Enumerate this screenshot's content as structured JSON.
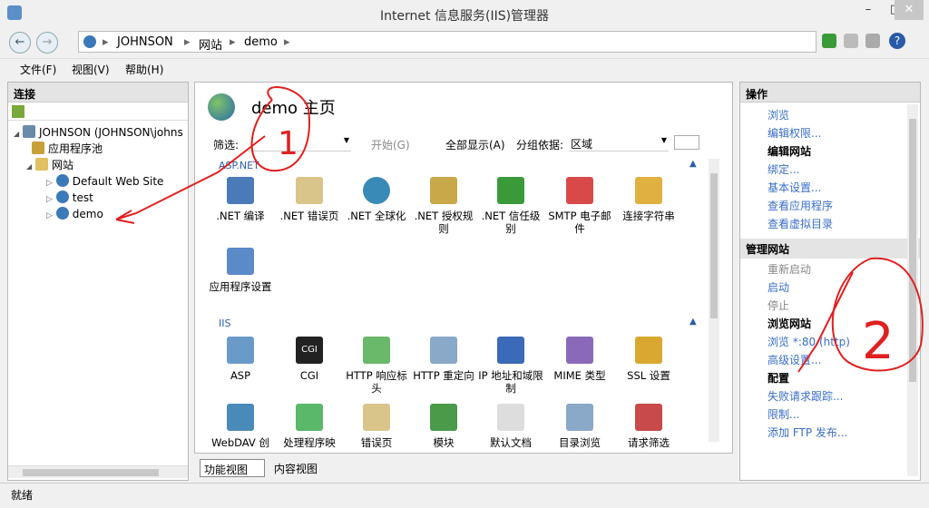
{
  "window": {
    "title": "Internet 信息服务(IIS)管理器",
    "min": "–",
    "max": "□",
    "close": "✕"
  },
  "address": {
    "crumbs": [
      "JOHNSON",
      "网站",
      "demo"
    ],
    "sep": "▸"
  },
  "menu": [
    "文件(F)",
    "视图(V)",
    "帮助(H)"
  ],
  "connections": {
    "title": "连接",
    "tree": [
      {
        "label": "JOHNSON (JOHNSON\\johns",
        "level": 0,
        "toggle": "◢"
      },
      {
        "label": "应用程序池",
        "level": 1,
        "toggle": ""
      },
      {
        "label": "网站",
        "level": 1,
        "toggle": "◢"
      },
      {
        "label": "Default Web Site",
        "level": 2,
        "toggle": "▷"
      },
      {
        "label": "test",
        "level": 2,
        "toggle": "▷"
      },
      {
        "label": "demo",
        "level": 2,
        "toggle": "▷"
      }
    ]
  },
  "main": {
    "title": "demo 主页",
    "filter_label": "筛选:",
    "start_label": "开始(G)",
    "show_all_label": "全部显示(A)",
    "group_label": "分组依据:",
    "group_value": "区域",
    "sections": [
      {
        "name": "ASP.NET",
        "items": [
          ".NET 编译",
          ".NET 错误页",
          ".NET 全球化",
          ".NET 授权规则",
          ".NET 信任级别",
          "SMTP 电子邮件",
          "连接字符串",
          "应用程序设置"
        ]
      },
      {
        "name": "IIS",
        "items": [
          "ASP",
          "CGI",
          "HTTP 响应标头",
          "HTTP 重定向",
          "IP 地址和域限制",
          "MIME 类型",
          "SSL 设置",
          "WebDAV 创",
          "处理程序映",
          "错误页",
          "模块",
          "默认文档",
          "目录浏览",
          "请求筛选"
        ]
      }
    ],
    "bottom_tabs": [
      "功能视图",
      "内容视图"
    ]
  },
  "actions": {
    "title": "操作",
    "items": [
      {
        "text": "浏览",
        "kind": "link"
      },
      {
        "text": "编辑权限...",
        "kind": "link"
      },
      {
        "text": "编辑网站",
        "kind": "head"
      },
      {
        "text": "绑定...",
        "kind": "link"
      },
      {
        "text": "基本设置...",
        "kind": "link"
      },
      {
        "text": "查看应用程序",
        "kind": "link"
      },
      {
        "text": "查看虚拟目录",
        "kind": "link"
      }
    ],
    "manage_title": "管理网站",
    "manage_items": [
      {
        "text": "重新启动",
        "kind": "dis"
      },
      {
        "text": "启动",
        "kind": "link"
      },
      {
        "text": "停止",
        "kind": "dis"
      },
      {
        "text": "浏览网站",
        "kind": "head"
      },
      {
        "text": "浏览 *:80 (http)",
        "kind": "link"
      },
      {
        "text": "高级设置...",
        "kind": "link"
      },
      {
        "text": "配置",
        "kind": "head"
      },
      {
        "text": "失败请求跟踪...",
        "kind": "link"
      },
      {
        "text": "限制...",
        "kind": "link"
      },
      {
        "text": "添加 FTP 发布...",
        "kind": "link"
      }
    ]
  },
  "status": "就绪",
  "annotations": [
    "1",
    "2"
  ]
}
